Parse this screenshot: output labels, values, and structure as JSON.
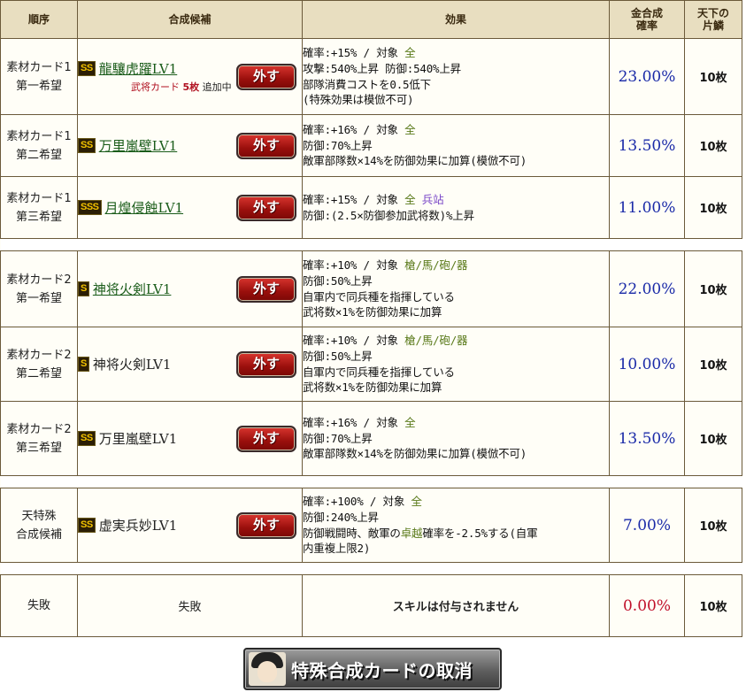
{
  "headers": {
    "order": "順序",
    "candidate": "合成候補",
    "effect": "効果",
    "rate": "金合成\n確率",
    "scale": "天下の\n片鱗"
  },
  "remove_label": "外す",
  "rows": [
    {
      "order1": "素材カード1",
      "order2": "第一希望",
      "rank": "SS",
      "skill": "龍驤虎躍LV1",
      "link": true,
      "note_prefix": "武将カード",
      "note_count": "5枚",
      "note_suffix": "追加中",
      "effect": [
        {
          "parts": [
            {
              "t": "確率:+15% / 対象 "
            },
            {
              "t": "全",
              "c": "tgt"
            }
          ]
        },
        {
          "parts": [
            {
              "t": "攻撃:540%上昇 防御:540%上昇"
            }
          ]
        },
        {
          "parts": [
            {
              "t": "部隊消費コストを0.5低下"
            }
          ]
        },
        {
          "parts": [
            {
              "t": "(特殊効果は模倣不可)"
            }
          ]
        }
      ],
      "rate": "23.00%",
      "scale": "10枚"
    },
    {
      "order1": "素材カード1",
      "order2": "第二希望",
      "rank": "SS",
      "skill": "万里嵐壁LV1",
      "link": true,
      "effect": [
        {
          "parts": [
            {
              "t": "確率:+16% / 対象 "
            },
            {
              "t": "全",
              "c": "tgt"
            }
          ]
        },
        {
          "parts": [
            {
              "t": "防御:70%上昇"
            }
          ]
        },
        {
          "parts": [
            {
              "t": "敵軍部隊数×14%を防御効果に加算(模倣不可)"
            }
          ]
        }
      ],
      "rate": "13.50%",
      "scale": "10枚"
    },
    {
      "order1": "素材カード1",
      "order2": "第三希望",
      "rank": "SSS",
      "skill": "月煌侵蝕LV1",
      "link": true,
      "effect": [
        {
          "parts": [
            {
              "t": "確率:+15% / 対象 "
            },
            {
              "t": "全",
              "c": "tgt"
            },
            {
              "t": " "
            },
            {
              "t": "兵站",
              "c": "tgt2"
            }
          ]
        },
        {
          "parts": [
            {
              "t": "防御:(2.5×防御参加武将数)%上昇"
            }
          ]
        }
      ],
      "rate": "11.00%",
      "scale": "10枚"
    },
    {
      "order1": "素材カード2",
      "order2": "第一希望",
      "rank": "S",
      "skill": "神将火剣LV1",
      "link": true,
      "effect": [
        {
          "parts": [
            {
              "t": "確率:+10% / 対象 "
            },
            {
              "t": "槍/馬/砲/器",
              "c": "tgt"
            }
          ]
        },
        {
          "parts": [
            {
              "t": "防御:50%上昇"
            }
          ]
        },
        {
          "parts": [
            {
              "t": "自軍内で同兵種を指揮している"
            }
          ]
        },
        {
          "parts": [
            {
              "t": "武将数×1%を防御効果に加算"
            }
          ]
        }
      ],
      "rate": "22.00%",
      "scale": "10枚"
    },
    {
      "order1": "素材カード2",
      "order2": "第二希望",
      "rank": "S",
      "skill": "神将火剣LV1",
      "link": false,
      "effect": [
        {
          "parts": [
            {
              "t": "確率:+10% / 対象 "
            },
            {
              "t": "槍/馬/砲/器",
              "c": "tgt"
            }
          ]
        },
        {
          "parts": [
            {
              "t": "防御:50%上昇"
            }
          ]
        },
        {
          "parts": [
            {
              "t": "自軍内で同兵種を指揮している"
            }
          ]
        },
        {
          "parts": [
            {
              "t": "武将数×1%を防御効果に加算"
            }
          ]
        }
      ],
      "rate": "10.00%",
      "scale": "10枚"
    },
    {
      "order1": "素材カード2",
      "order2": "第三希望",
      "rank": "SS",
      "skill": "万里嵐壁LV1",
      "link": false,
      "effect": [
        {
          "parts": [
            {
              "t": "確率:+16% / 対象 "
            },
            {
              "t": "全",
              "c": "tgt"
            }
          ]
        },
        {
          "parts": [
            {
              "t": "防御:70%上昇"
            }
          ]
        },
        {
          "parts": [
            {
              "t": "敵軍部隊数×14%を防御効果に加算(模倣不可)"
            }
          ]
        }
      ],
      "rate": "13.50%",
      "scale": "10枚"
    },
    {
      "order1": "天特殊",
      "order2": "合成候補",
      "rank": "SS",
      "skill": "虚実兵妙LV1",
      "link": false,
      "effect": [
        {
          "parts": [
            {
              "t": "確率:+100% / 対象 "
            },
            {
              "t": "全",
              "c": "tgt"
            }
          ]
        },
        {
          "parts": [
            {
              "t": "防御:240%上昇"
            }
          ]
        },
        {
          "parts": [
            {
              "t": "防御戦闘時、敵軍の"
            },
            {
              "t": "卓越",
              "c": "hl"
            },
            {
              "t": "確率を-2.5%する(自軍"
            }
          ]
        },
        {
          "parts": [
            {
              "t": "内重複上限2)"
            }
          ]
        }
      ],
      "rate": "7.00%",
      "scale": "10枚"
    }
  ],
  "fail_row": {
    "order": "失敗",
    "candidate": "失敗",
    "effect": "スキルは付与されません",
    "rate": "0.00%",
    "scale": "10枚"
  },
  "cancel_button": "特殊合成カードの取消"
}
